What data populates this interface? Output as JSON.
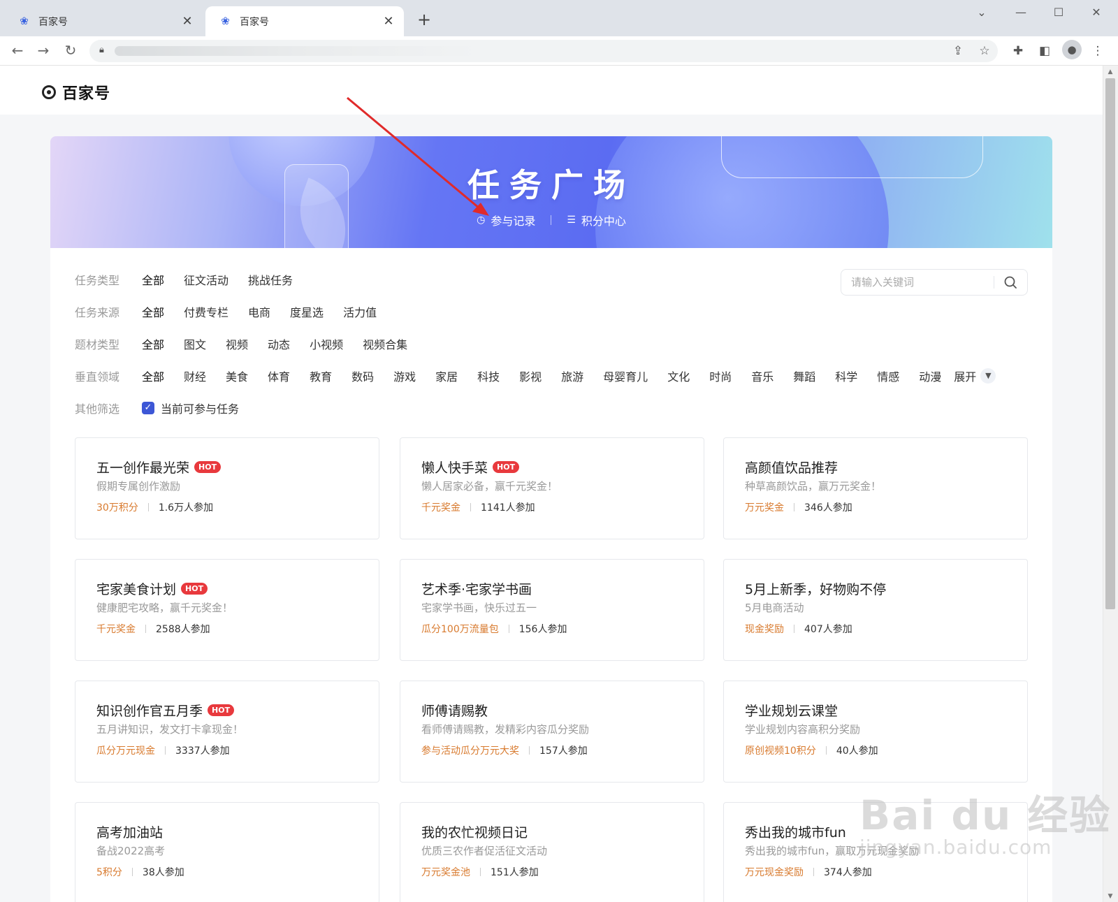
{
  "browser": {
    "tabs": [
      {
        "title": "百家号",
        "close": "✕"
      },
      {
        "title": "百家号",
        "close": "✕"
      }
    ],
    "new_tab": "+"
  },
  "site": {
    "logo_text": "百家号"
  },
  "hero": {
    "title": "任务广场",
    "links": [
      {
        "label": "参与记录",
        "icon": "clock-icon"
      },
      {
        "label": "积分中心",
        "icon": "coins-icon"
      }
    ]
  },
  "filters": {
    "task_type": {
      "label": "任务类型",
      "options": [
        "全部",
        "征文活动",
        "挑战任务"
      ],
      "selected": "全部"
    },
    "task_source": {
      "label": "任务来源",
      "options": [
        "全部",
        "付费专栏",
        "电商",
        "度星选",
        "活力值"
      ],
      "selected": "全部"
    },
    "material_type": {
      "label": "题材类型",
      "options": [
        "全部",
        "图文",
        "视频",
        "动态",
        "小视频",
        "视频合集"
      ],
      "selected": "全部"
    },
    "vertical": {
      "label": "垂直领域",
      "options": [
        "全部",
        "财经",
        "美食",
        "体育",
        "教育",
        "数码",
        "游戏",
        "家居",
        "科技",
        "影视",
        "旅游",
        "母婴育儿",
        "文化",
        "时尚",
        "音乐",
        "舞蹈",
        "科学",
        "情感",
        "动漫"
      ],
      "selected": "全部",
      "expand_label": "展开"
    },
    "other": {
      "label": "其他筛选",
      "checkbox_label": "当前可参与任务",
      "checked": true
    }
  },
  "search": {
    "placeholder": "请输入关键词"
  },
  "cards": [
    {
      "title": "五一创作最光荣",
      "hot": "HOT",
      "desc": "假期专属创作激励",
      "reward": "30万积分",
      "participants": "1.6万人参加"
    },
    {
      "title": "懒人快手菜",
      "hot": "HOT",
      "desc": "懒人居家必备，赢千元奖金！",
      "reward": "千元奖金",
      "participants": "1141人参加"
    },
    {
      "title": "高颜值饮品推荐",
      "hot": "",
      "desc": "种草高颜饮品，赢万元奖金！",
      "reward": "万元奖金",
      "participants": "346人参加"
    },
    {
      "title": "宅家美食计划",
      "hot": "HOT",
      "desc": "健康肥宅攻略，赢千元奖金！",
      "reward": "千元奖金",
      "participants": "2588人参加"
    },
    {
      "title": "艺术季·宅家学书画",
      "hot": "",
      "desc": "宅家学书画，快乐过五一",
      "reward": "瓜分100万流量包",
      "participants": "156人参加"
    },
    {
      "title": "5月上新季，好物购不停",
      "hot": "",
      "desc": "5月电商活动",
      "reward": "现金奖励",
      "participants": "407人参加"
    },
    {
      "title": "知识创作官五月季",
      "hot": "HOT",
      "desc": "五月讲知识，发文打卡拿现金！",
      "reward": "瓜分万元现金",
      "participants": "3337人参加"
    },
    {
      "title": "师傅请赐教",
      "hot": "",
      "desc": "看师傅请赐教，发精彩内容瓜分奖励",
      "reward": "参与活动瓜分万元大奖",
      "participants": "157人参加"
    },
    {
      "title": "学业规划云课堂",
      "hot": "",
      "desc": "学业规划内容高积分奖励",
      "reward": "原创视频10积分",
      "participants": "40人参加"
    },
    {
      "title": "高考加油站",
      "hot": "",
      "desc": "备战2022高考",
      "reward": "5积分",
      "participants": "38人参加"
    },
    {
      "title": "我的农忙视频日记",
      "hot": "",
      "desc": "优质三农作者促活征文活动",
      "reward": "万元奖金池",
      "participants": "151人参加"
    },
    {
      "title": "秀出我的城市fun",
      "hot": "",
      "desc": "秀出我的城市fun，赢取万元现金奖励",
      "reward": "万元现金奖励",
      "participants": "374人参加"
    }
  ],
  "watermark": {
    "line1": "Bai du 经验",
    "line2": "jingyan.baidu.com"
  },
  "colors": {
    "accent": "#3d57d6",
    "reward": "#d87a2e",
    "hot": "#e8393d"
  }
}
